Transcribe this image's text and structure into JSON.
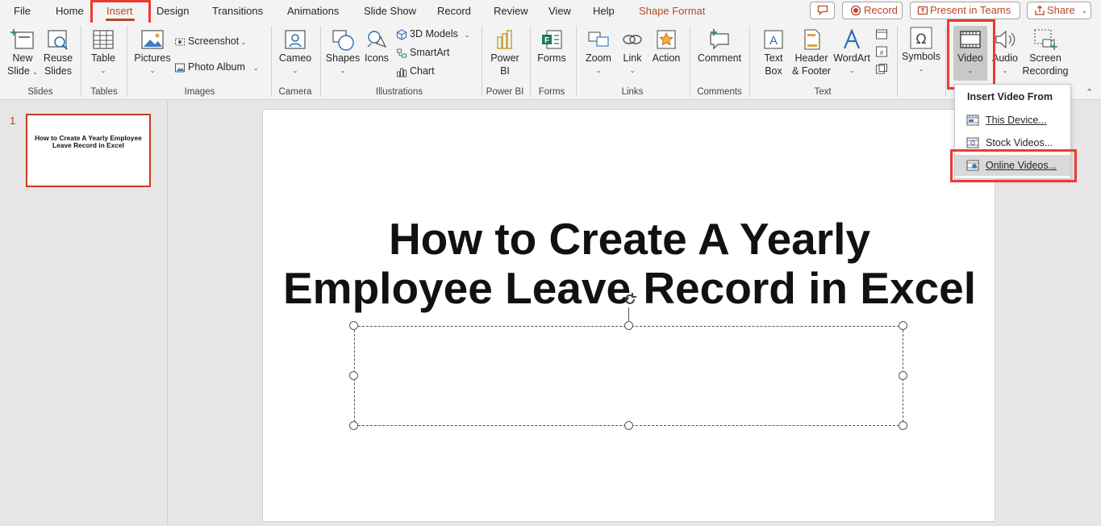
{
  "tabs": {
    "file": "File",
    "home": "Home",
    "insert": "Insert",
    "design": "Design",
    "transitions": "Transitions",
    "animations": "Animations",
    "slide_show": "Slide Show",
    "record": "Record",
    "review": "Review",
    "view": "View",
    "help": "Help",
    "shape_format": "Shape Format"
  },
  "top_buttons": {
    "record": "Record",
    "present_in_teams": "Present in Teams",
    "share": "Share"
  },
  "ribbon": {
    "new_slide": [
      "New",
      "Slide"
    ],
    "reuse_slides": [
      "Reuse",
      "Slides"
    ],
    "table": "Table",
    "pictures": "Pictures",
    "screenshot": "Screenshot",
    "photo_album": "Photo Album",
    "cameo": "Cameo",
    "shapes": "Shapes",
    "icons": "Icons",
    "models_3d": "3D Models",
    "smartart": "SmartArt",
    "chart": "Chart",
    "power_bi": [
      "Power",
      "BI"
    ],
    "forms": "Forms",
    "zoom": "Zoom",
    "link": "Link",
    "action": "Action",
    "comment": "Comment",
    "text_box": [
      "Text",
      "Box"
    ],
    "header_footer": [
      "Header",
      "& Footer"
    ],
    "wordart": "WordArt",
    "symbols": "Symbols",
    "video": "Video",
    "audio": "Audio",
    "screen_recording": [
      "Screen",
      "Recording"
    ]
  },
  "groups": {
    "slides": "Slides",
    "tables": "Tables",
    "images": "Images",
    "camera": "Camera",
    "illustrations": "Illustrations",
    "power_bi": "Power BI",
    "forms": "Forms",
    "links": "Links",
    "comments": "Comments",
    "text": "Text"
  },
  "slide_panel": {
    "slide_number": "1",
    "thumbnail_text": "How to Create A Yearly Employee Leave Record in Excel"
  },
  "slide": {
    "title_line1": "How to Create A Yearly",
    "title_line2": "Employee Leave Record in Excel"
  },
  "video_menu": {
    "header": "Insert Video From",
    "items": [
      "This Device...",
      "Stock Videos...",
      "Online Videos..."
    ],
    "selected_index": 2
  },
  "colors": {
    "accent": "#b7472a",
    "highlight_box": "#ee3a33",
    "ribbon_bg": "#f3f3f3",
    "canvas_bg": "#e6e6e6"
  }
}
